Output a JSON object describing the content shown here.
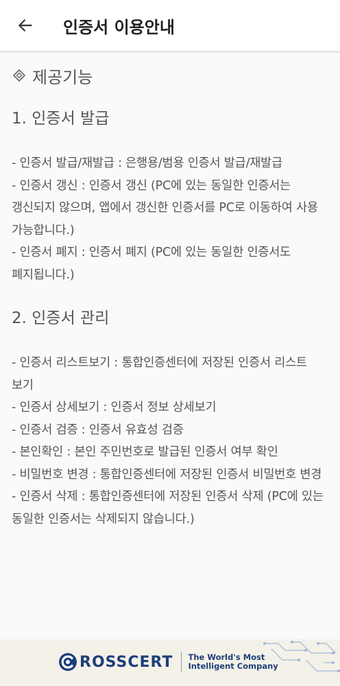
{
  "header": {
    "title": "인증서 이용안내"
  },
  "content": {
    "section_title": "제공기능",
    "section_icon": "diamond-icon",
    "groups": [
      {
        "heading": "1. 인증서 발급",
        "items": [
          "- 인증서 발급/재발급 : 은행용/범용 인증서 발급/재발급",
          "- 인증서 갱신 : 인증서 갱신 (PC에 있는 동일한 인증서는 갱신되지 않으며, 앱에서 갱신한 인증서를 PC로 이동하여 사용 가능합니다.)",
          "- 인증서 폐지 : 인증서 폐지 (PC에 있는 동일한 인증서도 폐지됩니다.)"
        ]
      },
      {
        "heading": "2. 인증서 관리",
        "items": [
          "- 인증서 리스트보기 : 통합인증센터에 저장된 인증서 리스트 보기",
          "- 인증서 상세보기 : 인증서 정보 상세보기",
          "- 인증서 검증 : 인증서 유효성 검증",
          "- 본인확인 : 본인 주민번호로 발급된 인증서 여부 확인",
          "- 비밀번호 변경 : 통합인증센터에 저장된 인증서 비밀번호 변경",
          "- 인증서 삭제 : 통합인증센터에 저장된 인증서 삭제 (PC에 있는 동일한 인증서는 삭제되지 않습니다.)"
        ]
      }
    ]
  },
  "footer": {
    "logo_text": "ROSSCERT",
    "tagline_line1": "The World's Most",
    "tagline_line2": "Intelligent Company",
    "brand_color": "#1d3f7a",
    "background_color": "#f4f1e8"
  }
}
